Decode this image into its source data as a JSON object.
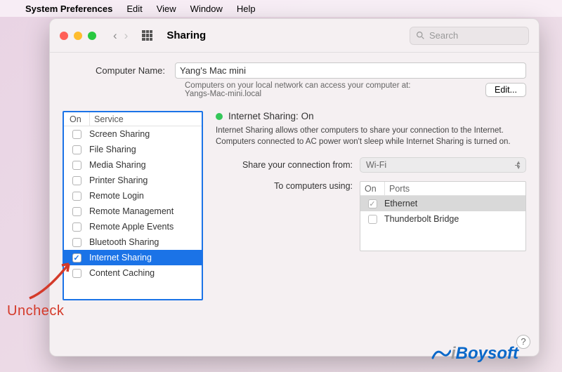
{
  "menubar": {
    "app": "System Preferences",
    "items": [
      "Edit",
      "View",
      "Window",
      "Help"
    ]
  },
  "toolbar": {
    "title": "Sharing",
    "search_placeholder": "Search"
  },
  "computer": {
    "label": "Computer Name:",
    "value": "Yang's Mac mini",
    "note_line1": "Computers on your local network can access your computer at:",
    "note_line2": "Yangs-Mac-mini.local",
    "edit_label": "Edit..."
  },
  "services": {
    "head_on": "On",
    "head_service": "Service",
    "items": [
      {
        "label": "Screen Sharing",
        "checked": false,
        "selected": false
      },
      {
        "label": "File Sharing",
        "checked": false,
        "selected": false
      },
      {
        "label": "Media Sharing",
        "checked": false,
        "selected": false
      },
      {
        "label": "Printer Sharing",
        "checked": false,
        "selected": false
      },
      {
        "label": "Remote Login",
        "checked": false,
        "selected": false
      },
      {
        "label": "Remote Management",
        "checked": false,
        "selected": false
      },
      {
        "label": "Remote Apple Events",
        "checked": false,
        "selected": false
      },
      {
        "label": "Bluetooth Sharing",
        "checked": false,
        "selected": false
      },
      {
        "label": "Internet Sharing",
        "checked": true,
        "selected": true
      },
      {
        "label": "Content Caching",
        "checked": false,
        "selected": false
      }
    ]
  },
  "detail": {
    "status_title": "Internet Sharing: On",
    "desc": "Internet Sharing allows other computers to share your connection to the Internet. Computers connected to AC power won't sleep while Internet Sharing is turned on.",
    "share_from_label": "Share your connection from:",
    "share_from_value": "Wi-Fi",
    "to_label": "To computers using:",
    "ports_head_on": "On",
    "ports_head_ports": "Ports",
    "ports": [
      {
        "label": "Ethernet",
        "checked": true,
        "selected": true
      },
      {
        "label": "Thunderbolt Bridge",
        "checked": false,
        "selected": false
      }
    ]
  },
  "annotation": {
    "uncheck": "Uncheck"
  },
  "help": "?",
  "logo": "iBoysoft"
}
